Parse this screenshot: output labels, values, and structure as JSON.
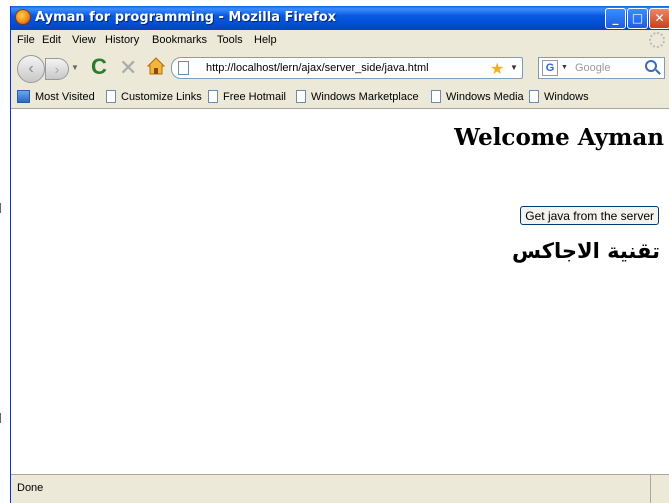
{
  "window": {
    "title": "Ayman for programming - Mozilla Firefox"
  },
  "menu": [
    "File",
    "Edit",
    "View",
    "History",
    "Bookmarks",
    "Tools",
    "Help"
  ],
  "nav": {
    "url": "http://localhost/lern/ajax/server_side/java.html",
    "search_placeholder": "Google",
    "search_engine_letter": "G"
  },
  "bookmarks": [
    "Most Visited",
    "Customize Links",
    "Free Hotmail",
    "Windows Marketplace",
    "Windows Media",
    "Windows"
  ],
  "page": {
    "heading": "Welcome Ayman",
    "button_label": "Get java from the server",
    "subheading": "تقنية الاجاكس"
  },
  "status": {
    "text": "Done"
  }
}
